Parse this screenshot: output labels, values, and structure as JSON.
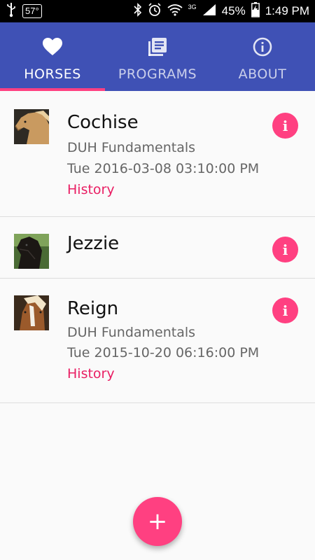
{
  "status_bar": {
    "temperature": "57°",
    "network": "3G",
    "battery": "45%",
    "time": "1:49 PM"
  },
  "tabs": [
    {
      "label": "HORSES",
      "icon": "heart-icon",
      "active": true
    },
    {
      "label": "PROGRAMS",
      "icon": "list-book-icon",
      "active": false
    },
    {
      "label": "ABOUT",
      "icon": "info-circle-icon",
      "active": false
    }
  ],
  "horses": [
    {
      "name": "Cochise",
      "program": "DUH Fundamentals",
      "date": "Tue 2016-03-08 03:10:00 PM",
      "link": "History"
    },
    {
      "name": "Jezzie"
    },
    {
      "name": "Reign",
      "program": "DUH Fundamentals",
      "date": "Tue 2015-10-20 06:16:00 PM",
      "link": "History"
    }
  ],
  "info_button_label": "i",
  "fab_label": "+",
  "colors": {
    "primary": "#3f51b5",
    "accent": "#ff4081",
    "link": "#e91e63"
  }
}
